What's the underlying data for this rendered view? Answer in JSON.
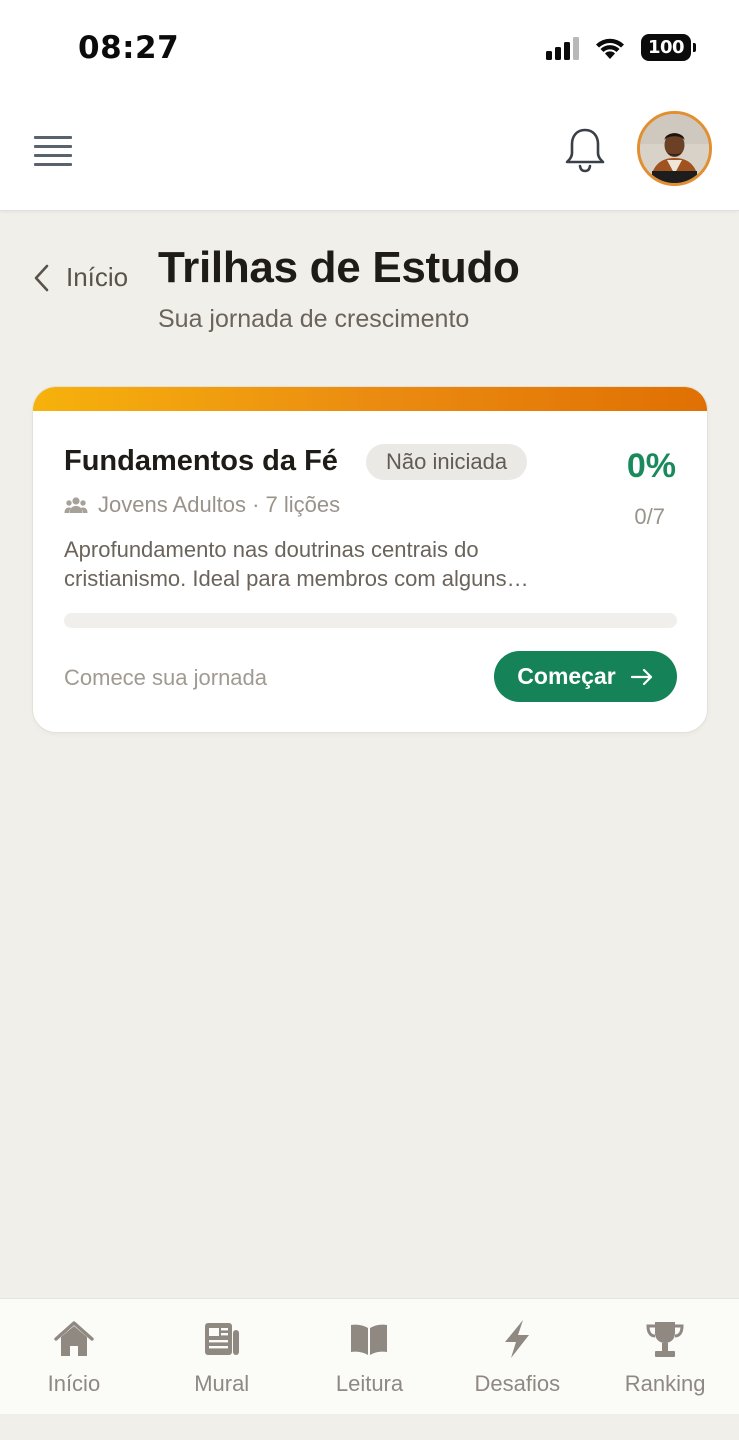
{
  "status_bar": {
    "time": "08:27",
    "battery": "100",
    "icons": [
      "signal-icon",
      "wifi-icon",
      "battery-icon"
    ]
  },
  "app_bar": {
    "icons": [
      "menu-icon",
      "bell-icon",
      "avatar"
    ]
  },
  "header": {
    "back_label": "Início",
    "title": "Trilhas de Estudo",
    "subtitle": "Sua jornada de crescimento"
  },
  "track_card": {
    "accent_colors": [
      "#f6b20c",
      "#e07003"
    ],
    "title": "Fundamentos da Fé",
    "status": "Não iniciada",
    "percent": "0%",
    "progress_fraction": 0,
    "count": "0/7",
    "meta": "Jovens Adultos · 7 lições",
    "description": "Aprofundamento nas doutrinas centrais do cristianismo. Ideal para membros com alguns…",
    "footer_text": "Comece sua jornada",
    "button_label": "Começar"
  },
  "bottom_nav": {
    "items": [
      {
        "label": "Início",
        "icon": "home-icon"
      },
      {
        "label": "Mural",
        "icon": "newspaper-icon"
      },
      {
        "label": "Leitura",
        "icon": "book-icon"
      },
      {
        "label": "Desafios",
        "icon": "lightning-icon"
      },
      {
        "label": "Ranking",
        "icon": "trophy-icon"
      }
    ]
  },
  "colors": {
    "accent_green": "#158257",
    "percent_green": "#1a8a5c",
    "background": "#f0efe9",
    "avatar_ring": "#e28f32"
  }
}
